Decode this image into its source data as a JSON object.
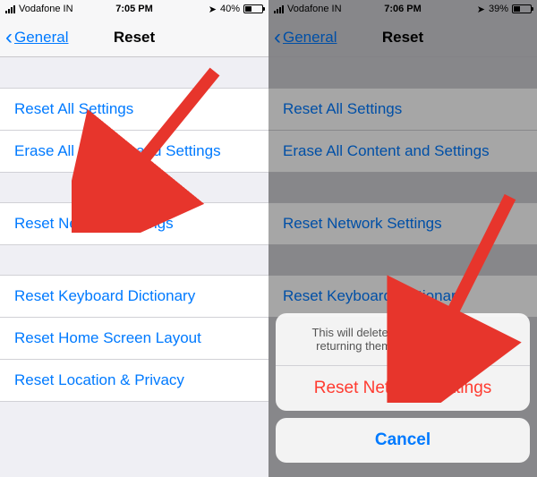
{
  "left": {
    "status": {
      "carrier": "Vodafone IN",
      "time": "7:05 PM",
      "battery_pct": "40%",
      "battery_fill_pct": 40
    },
    "nav": {
      "back_label": "General",
      "title": "Reset"
    },
    "group1": {
      "reset_all": "Reset All Settings",
      "erase_all": "Erase All Content and Settings"
    },
    "group2": {
      "reset_network": "Reset Network Settings"
    },
    "group3": {
      "reset_keyboard": "Reset Keyboard Dictionary",
      "reset_home": "Reset Home Screen Layout",
      "reset_location": "Reset Location & Privacy"
    }
  },
  "right": {
    "status": {
      "carrier": "Vodafone IN",
      "time": "7:06 PM",
      "battery_pct": "39%",
      "battery_fill_pct": 39
    },
    "nav": {
      "back_label": "General",
      "title": "Reset"
    },
    "group1": {
      "reset_all": "Reset All Settings",
      "erase_all": "Erase All Content and Settings"
    },
    "group2": {
      "reset_network": "Reset Network Settings"
    },
    "group3": {
      "reset_keyboard": "Reset Keyboard Dictionary"
    },
    "sheet": {
      "message": "This will delete all network settings, returning them to factory defaults.",
      "confirm": "Reset Network Settings",
      "cancel": "Cancel"
    }
  }
}
